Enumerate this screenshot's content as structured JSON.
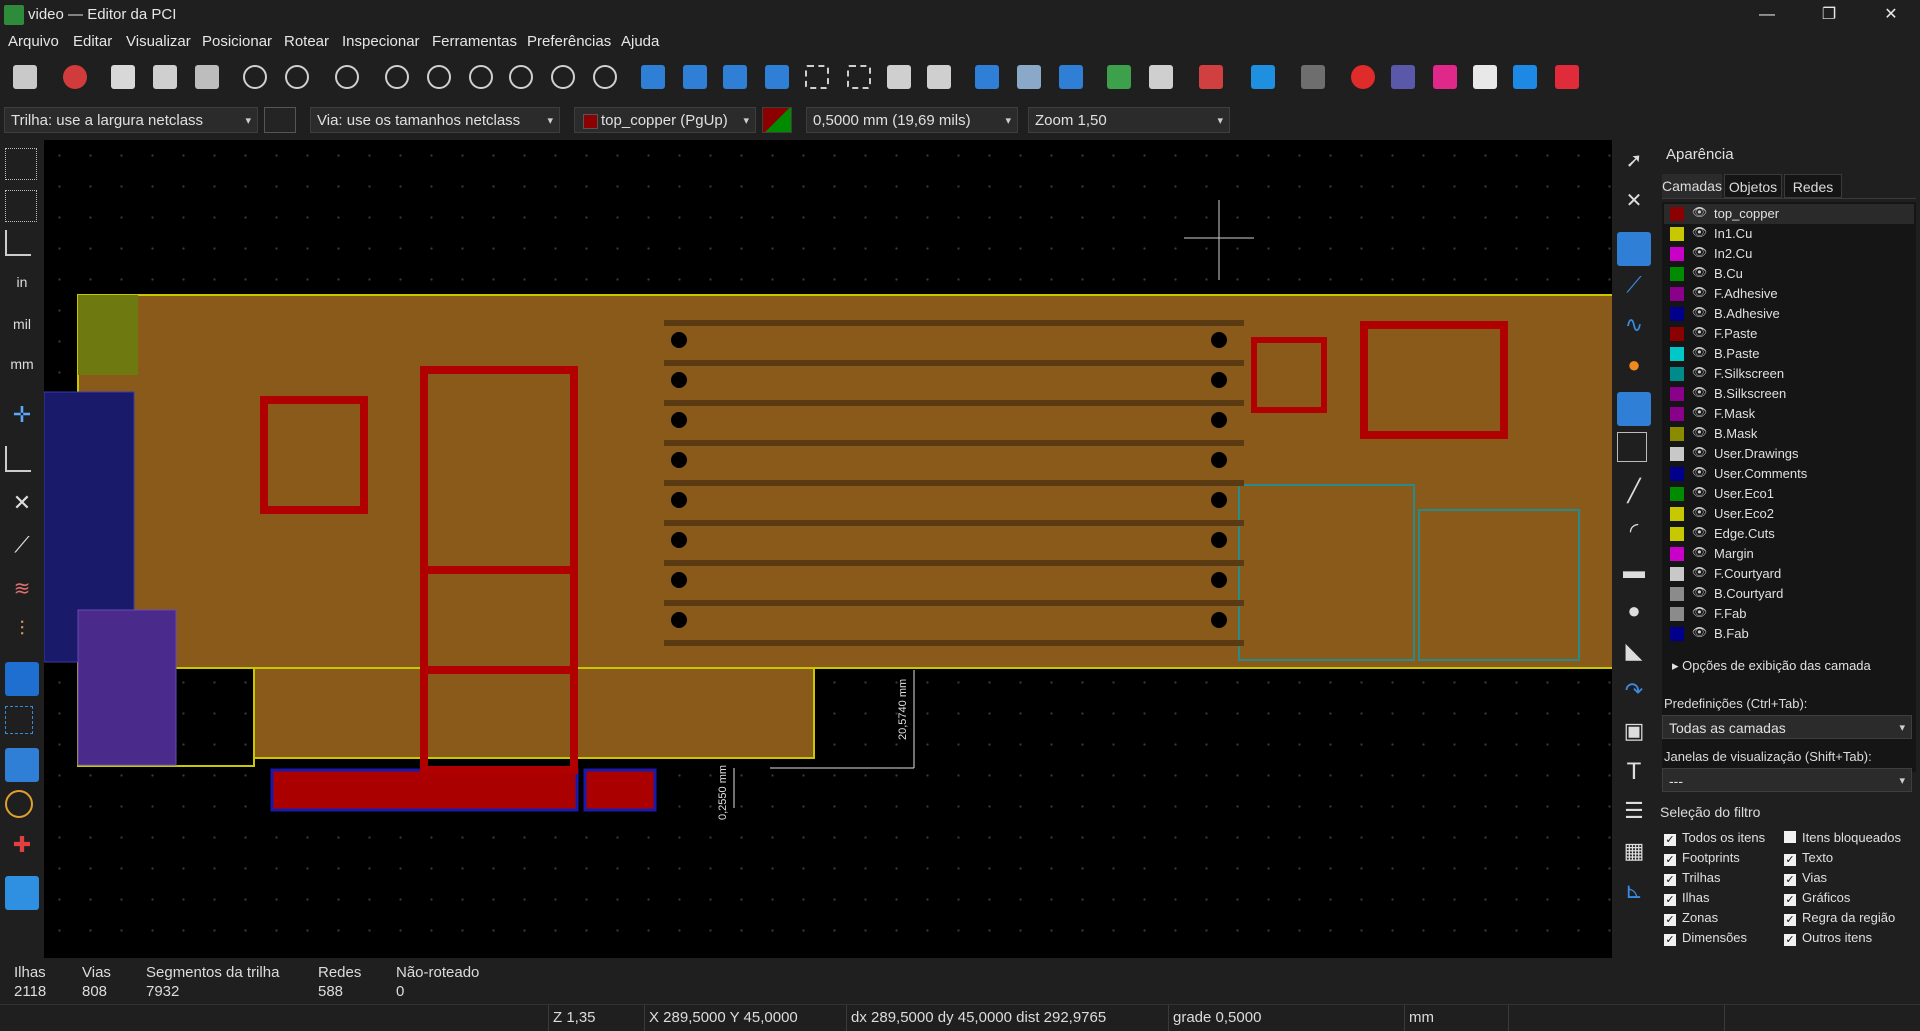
{
  "window": {
    "title": "video — Editor da PCI",
    "minimize": "—",
    "restore": "❐",
    "close": "✕"
  },
  "menu": [
    "Arquivo",
    "Editar",
    "Visualizar",
    "Posicionar",
    "Rotear",
    "Inspecionar",
    "Ferramentas",
    "Preferências",
    "Ajuda"
  ],
  "toolbar2": {
    "track_width": "Trilha: use a largura netclass",
    "via_size": "Via: use os tamanhos netclass",
    "layer": "top_copper (PgUp)",
    "grid": "0,5000 mm (19,69 mils)",
    "zoom": "Zoom 1,50"
  },
  "left_toolbar": {
    "units_in": "in",
    "units_mil": "mil",
    "units_mm": "mm"
  },
  "canvas": {
    "dimension_1": "20,5740 mm",
    "dimension_2": "0,2550 mm"
  },
  "panel": {
    "title": "Aparência",
    "tabs": [
      "Camadas",
      "Objetos",
      "Redes"
    ],
    "layers": [
      {
        "name": "top_copper",
        "color": "#8b0000"
      },
      {
        "name": "In1.Cu",
        "color": "#c8c800"
      },
      {
        "name": "In2.Cu",
        "color": "#c800c8"
      },
      {
        "name": "B.Cu",
        "color": "#008b00"
      },
      {
        "name": "F.Adhesive",
        "color": "#8b008b"
      },
      {
        "name": "B.Adhesive",
        "color": "#00008b"
      },
      {
        "name": "F.Paste",
        "color": "#8b0000"
      },
      {
        "name": "B.Paste",
        "color": "#00c8c8"
      },
      {
        "name": "F.Silkscreen",
        "color": "#008b8b"
      },
      {
        "name": "B.Silkscreen",
        "color": "#8b008b"
      },
      {
        "name": "F.Mask",
        "color": "#8b008b"
      },
      {
        "name": "B.Mask",
        "color": "#8b8b00"
      },
      {
        "name": "User.Drawings",
        "color": "#c8c8c8"
      },
      {
        "name": "User.Comments",
        "color": "#00008b"
      },
      {
        "name": "User.Eco1",
        "color": "#008b00"
      },
      {
        "name": "User.Eco2",
        "color": "#c8c800"
      },
      {
        "name": "Edge.Cuts",
        "color": "#c8c800"
      },
      {
        "name": "Margin",
        "color": "#c800c8"
      },
      {
        "name": "F.Courtyard",
        "color": "#c8c8c8"
      },
      {
        "name": "B.Courtyard",
        "color": "#8b8b8b"
      },
      {
        "name": "F.Fab",
        "color": "#8b8b8b"
      },
      {
        "name": "B.Fab",
        "color": "#00008b"
      }
    ],
    "layer_options": "Opções de exibição das camada",
    "presets_label": "Predefinições (Ctrl+Tab):",
    "presets_value": "Todas as camadas",
    "viewports_label": "Janelas de visualização (Shift+Tab):",
    "viewports_value": "---",
    "filter_title": "Seleção do filtro",
    "filter_left": [
      "Todos os itens",
      "Footprints",
      "Trilhas",
      "Ilhas",
      "Zonas",
      "Dimensões"
    ],
    "filter_right": [
      "Itens bloqueados",
      "Texto",
      "Vias",
      "Gráficos",
      "Regra da região",
      "Outros itens"
    ],
    "filter_left_checked": [
      true,
      true,
      true,
      true,
      true,
      true
    ],
    "filter_right_checked": [
      false,
      true,
      true,
      true,
      true,
      true
    ]
  },
  "stats": [
    {
      "label": "Ilhas",
      "value": "2118"
    },
    {
      "label": "Vias",
      "value": "808"
    },
    {
      "label": "Segmentos da trilha",
      "value": "7932"
    },
    {
      "label": "Redes",
      "value": "588"
    },
    {
      "label": "Não-roteado",
      "value": "0"
    }
  ],
  "statusbar": {
    "zoom": "Z 1,35",
    "xy": "X 289,5000  Y 45,0000",
    "dxy": "dx 289,5000  dy 45,0000  dist 292,9765",
    "grid": "grade 0,5000",
    "units": "mm"
  }
}
